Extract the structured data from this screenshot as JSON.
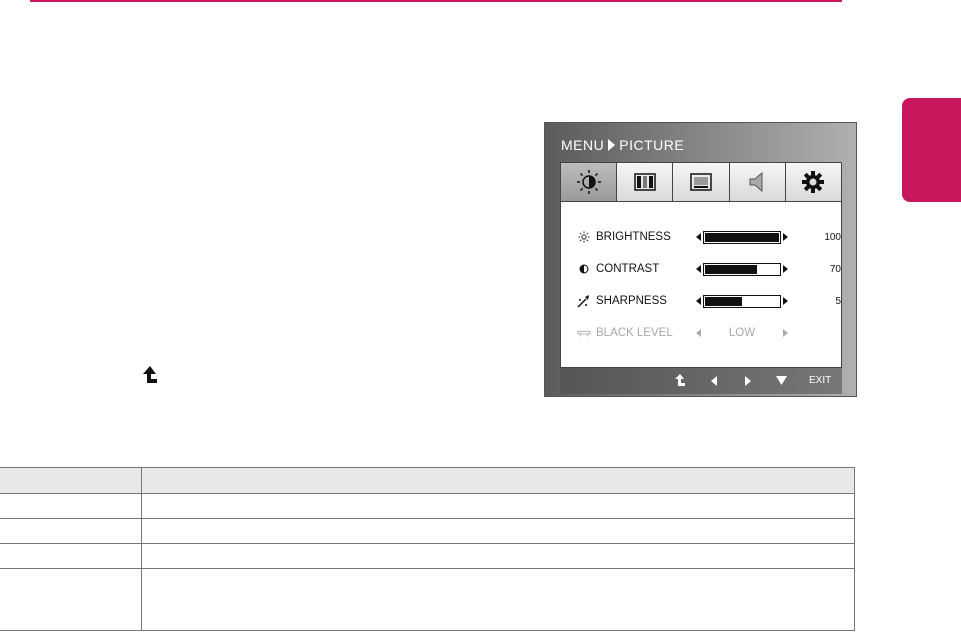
{
  "page": {
    "accent_color": "#c8175d",
    "return_icon": "return-arrow-icon"
  },
  "osd": {
    "title_menu": "MENU",
    "title_section": "PICTURE",
    "tabs": [
      {
        "icon": "picture-icon",
        "active": true
      },
      {
        "icon": "color-bars-icon",
        "active": false
      },
      {
        "icon": "display-icon",
        "active": false
      },
      {
        "icon": "sound-icon",
        "active": false
      },
      {
        "icon": "settings-icon",
        "active": false
      }
    ],
    "rows": [
      {
        "label": "BRIGHTNESS",
        "value": "100",
        "level": 1.0,
        "icon": "sun-icon"
      },
      {
        "label": "CONTRAST",
        "value": "70",
        "level": 0.7,
        "icon": "contrast-icon"
      },
      {
        "label": "SHARPNESS",
        "value": "5",
        "level": 0.5,
        "icon": "sharpness-icon"
      },
      {
        "label": "BLACK LEVEL",
        "option": "LOW",
        "disabled": true,
        "icon": "black-level-icon"
      }
    ],
    "footer": {
      "buttons": [
        "return-icon",
        "left-arrow-icon",
        "right-arrow-icon",
        "down-arrow-icon"
      ],
      "exit_label": "EXIT"
    }
  },
  "table": {
    "header": [
      "",
      ""
    ],
    "rows": [
      [
        "",
        ""
      ],
      [
        "",
        ""
      ],
      [
        "",
        ""
      ],
      [
        "",
        ""
      ]
    ]
  }
}
